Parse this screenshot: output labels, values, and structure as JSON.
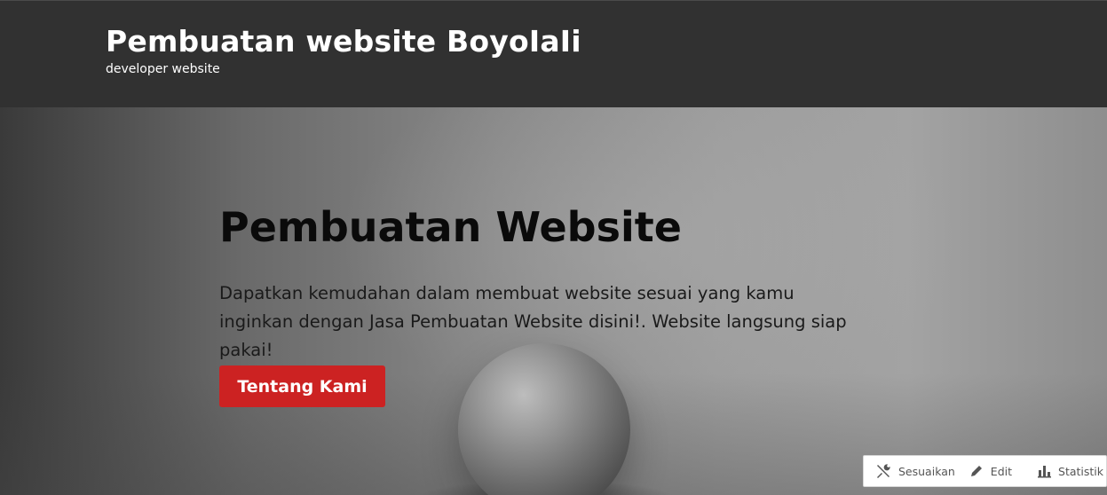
{
  "header": {
    "site_title": "Pembuatan website BoyoIaIi",
    "tagline": "developer website"
  },
  "hero": {
    "title": "Pembuatan Website",
    "description": "Dapatkan kemudahan dalam membuat website sesuai yang kamu inginkan dengan Jasa Pembuatan Website disini!. Website langsung siap pakai!",
    "button_label": "Tentang Kami",
    "button_color": "#cc2222"
  },
  "admin_bar": {
    "items": [
      {
        "label": "Sesuaikan",
        "icon": "tools-icon"
      },
      {
        "label": "Edit",
        "icon": "pencil-icon"
      },
      {
        "label": "Statistik",
        "icon": "bar-chart-icon"
      }
    ]
  },
  "colors": {
    "header_bg": "#313131",
    "header_text": "#ffffff"
  }
}
